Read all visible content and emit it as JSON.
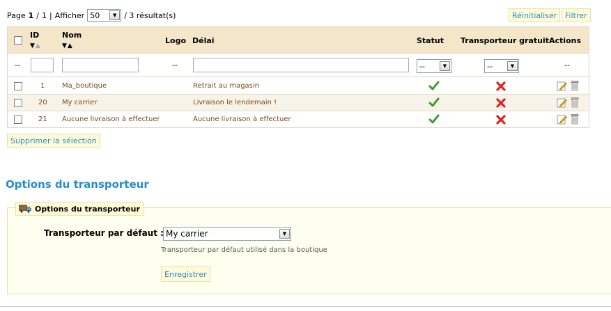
{
  "pager": {
    "page_label": "Page",
    "page_current": "1",
    "page_sep": "/",
    "page_total": "1",
    "pipe": "|",
    "afficher_label": "Afficher",
    "per_page": "50",
    "results": "/ 3 résultat(s)"
  },
  "toolbar": {
    "reset_label": "Réinitialiser",
    "filter_label": "Filtrer"
  },
  "table": {
    "headers": {
      "id": "ID",
      "name": "Nom",
      "logo": "Logo",
      "delay": "Délai",
      "status": "Statut",
      "free": "Transporteur gratuit",
      "actions": "Actions"
    },
    "filters": {
      "dash": "--",
      "status_value": "--",
      "free_value": "--"
    },
    "rows": [
      {
        "id": "1",
        "name": "Ma_boutique",
        "delay": "Retrait au magasin",
        "status": "active",
        "free": "no"
      },
      {
        "id": "20",
        "name": "My carrier",
        "delay": "Livraison le lendemain !",
        "status": "active",
        "free": "no"
      },
      {
        "id": "21",
        "name": "Aucune livraison à effectuer",
        "delay": "Aucune livraison à effectuer",
        "status": "active",
        "free": "no"
      }
    ]
  },
  "bulk": {
    "delete_label": "Supprimer la sélection"
  },
  "options": {
    "section_title": "Options du transporteur",
    "legend": "Options du transporteur",
    "default_label": "Transporteur par défaut :",
    "default_value": "My carrier",
    "help": "Transporteur par défaut utilisé dans la boutique",
    "save_label": "Enregistrer"
  },
  "colors": {
    "accent": "#268ccd",
    "header_bg": "#f4e6c9",
    "link": "#7b4a1e",
    "check": "#3a9a2a",
    "cross": "#e02020"
  }
}
